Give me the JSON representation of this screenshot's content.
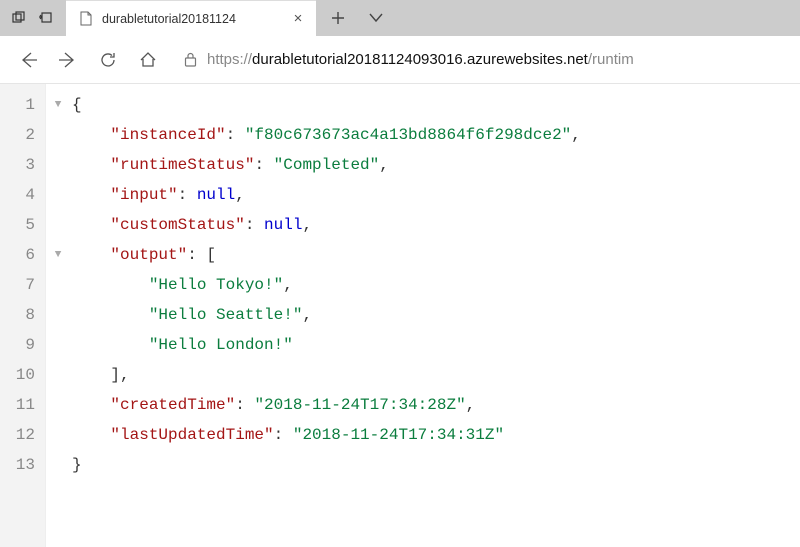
{
  "titlebar": {
    "tab_title": "durabletutorial20181124"
  },
  "navbar": {
    "url_scheme": "https://",
    "url_host": "durabletutorial20181124093016.azurewebsites.net",
    "url_path": "/runtim"
  },
  "lines": [
    {
      "n": 1,
      "fold": "▼",
      "indent": 0,
      "open": "{"
    },
    {
      "n": 2,
      "indent": 1,
      "key": "instanceId",
      "type": "str",
      "val": "f80c673673ac4a13bd8864f6f298dce2",
      "comma": true
    },
    {
      "n": 3,
      "indent": 1,
      "key": "runtimeStatus",
      "type": "str",
      "val": "Completed",
      "comma": true
    },
    {
      "n": 4,
      "indent": 1,
      "key": "input",
      "type": "lit",
      "val": "null",
      "comma": true
    },
    {
      "n": 5,
      "indent": 1,
      "key": "customStatus",
      "type": "lit",
      "val": "null",
      "comma": true
    },
    {
      "n": 6,
      "fold": "▼",
      "indent": 1,
      "key": "output",
      "type": "arr_open"
    },
    {
      "n": 7,
      "indent": 2,
      "type": "str_item",
      "val": "Hello Tokyo!",
      "comma": true
    },
    {
      "n": 8,
      "indent": 2,
      "type": "str_item",
      "val": "Hello Seattle!",
      "comma": true
    },
    {
      "n": 9,
      "indent": 2,
      "type": "str_item",
      "val": "Hello London!"
    },
    {
      "n": 10,
      "indent": 1,
      "close": "]",
      "comma": true
    },
    {
      "n": 11,
      "indent": 1,
      "key": "createdTime",
      "type": "str",
      "val": "2018-11-24T17:34:28Z",
      "comma": true
    },
    {
      "n": 12,
      "indent": 1,
      "key": "lastUpdatedTime",
      "type": "str",
      "val": "2018-11-24T17:34:31Z"
    },
    {
      "n": 13,
      "indent": 0,
      "close": "}"
    }
  ]
}
